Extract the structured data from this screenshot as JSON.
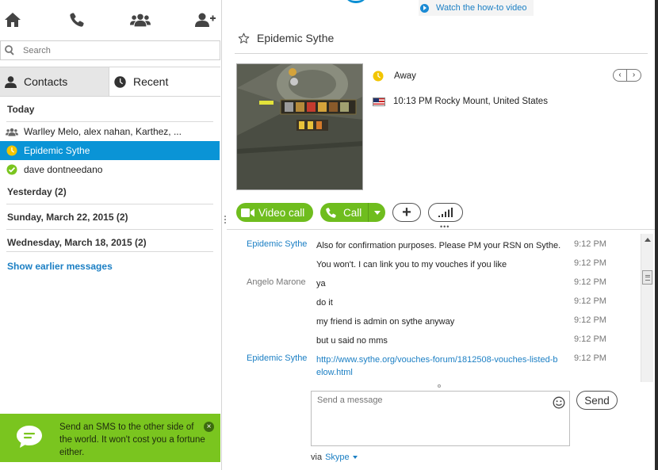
{
  "nav": {
    "home_icon": "home-icon",
    "call_icon": "phone-icon",
    "groups_icon": "group-icon",
    "add_contact_icon": "add-contact-icon"
  },
  "search": {
    "placeholder": "Search"
  },
  "tabs": [
    {
      "label": "Contacts",
      "active": false
    },
    {
      "label": "Recent",
      "active": true
    }
  ],
  "recent": {
    "today_label": "Today",
    "today_items": [
      {
        "label": "Warlley Melo, alex nahan, Karthez, ...",
        "icon": "group-icon",
        "selected": false
      },
      {
        "label": "Epidemic Sythe",
        "icon": "away-status-icon",
        "selected": true
      },
      {
        "label": "dave dontneedano",
        "icon": "online-status-icon",
        "selected": false
      }
    ],
    "sections": [
      {
        "label": "Yesterday (2)"
      },
      {
        "label": "Sunday, March 22, 2015 (2)"
      },
      {
        "label": "Wednesday, March 18, 2015 (2)"
      }
    ],
    "show_earlier": "Show earlier messages"
  },
  "sms_banner": {
    "text": "Send an SMS to the other side of the world. It won't cost you a fortune either."
  },
  "header": {
    "howto_label": "Watch the how-to video"
  },
  "conversation": {
    "title": "Epidemic Sythe",
    "status": "Away",
    "location": "10:13 PM Rocky Mount, United States",
    "video_call_label": "Video call",
    "call_label": "Call",
    "add_label": "+"
  },
  "messages": [
    {
      "sender": "Epidemic Sythe",
      "sender_style": "contact",
      "text": "Also for confirmation purposes. Please PM your RSN on Sythe.",
      "time": "9:12 PM"
    },
    {
      "sender": "",
      "sender_style": "contact",
      "text": "You won't. I can link you to my vouches if you like",
      "time": "9:12 PM"
    },
    {
      "sender": "Angelo Marone",
      "sender_style": "self",
      "text": "ya",
      "time": "9:12 PM"
    },
    {
      "sender": "",
      "sender_style": "self",
      "text": "do it",
      "time": "9:12 PM"
    },
    {
      "sender": "",
      "sender_style": "self",
      "text": "my friend is admin on sythe anyway",
      "time": "9:12 PM"
    },
    {
      "sender": "",
      "sender_style": "self",
      "text": "but u said no mms",
      "time": "9:12 PM"
    },
    {
      "sender": "Epidemic Sythe",
      "sender_style": "contact",
      "text": "http://www.sythe.org/vouches-forum/1812508-vouches-listed-below.html",
      "time": "9:12 PM",
      "is_link": true
    }
  ],
  "compose": {
    "placeholder": "Send a message",
    "send_label": "Send",
    "via_label": "via",
    "via_service": "Skype"
  },
  "colors": {
    "accent": "#0a94d6",
    "green": "#6fbd1e",
    "sms_banner": "#7ac51f",
    "link": "#1b7fc4",
    "away": "#f2c500",
    "online": "#7ac51f"
  }
}
